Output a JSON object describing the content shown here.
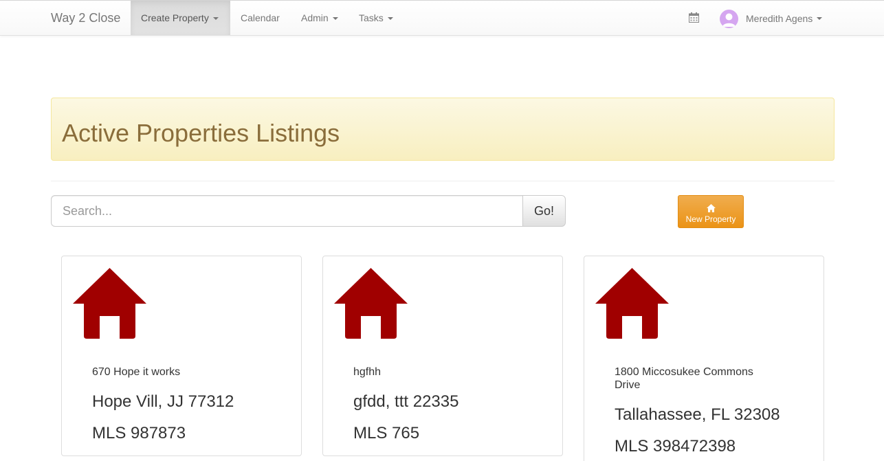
{
  "navbar": {
    "brand": "Way 2 Close",
    "items": [
      {
        "label": "Create Property",
        "dropdown": true,
        "active": true
      },
      {
        "label": "Calendar",
        "dropdown": false,
        "active": false
      },
      {
        "label": "Admin",
        "dropdown": true,
        "active": false
      },
      {
        "label": "Tasks",
        "dropdown": true,
        "active": false
      }
    ],
    "calendar_icon": "calendar-icon",
    "user": {
      "name": "Meredith Agens",
      "avatar_icon": "user-avatar-icon"
    }
  },
  "banner": {
    "title": "Active Properties Listings"
  },
  "search": {
    "placeholder": "Search...",
    "value": "",
    "go_label": "Go!"
  },
  "new_property": {
    "label": "New Property",
    "icon": "home-icon"
  },
  "properties": [
    {
      "street": "670 Hope it works",
      "city_line": "Hope Vill, JJ 77312",
      "mls": "MLS 987873",
      "icon": "house-icon"
    },
    {
      "street": "hgfhh",
      "city_line": "gfdd, ttt 22335",
      "mls": "MLS 765",
      "icon": "house-icon"
    },
    {
      "street": "1800 Miccosukee Commons Drive",
      "city_line": "Tallahassee, FL 32308",
      "mls": "MLS 398472398",
      "icon": "house-icon"
    }
  ],
  "colors": {
    "house_icon": "#a00000",
    "banner_title": "#8a6d3b",
    "banner_bg": "#fcf8e3",
    "new_property_button": "#f0ad4e",
    "avatar": "#d5a6f0"
  }
}
